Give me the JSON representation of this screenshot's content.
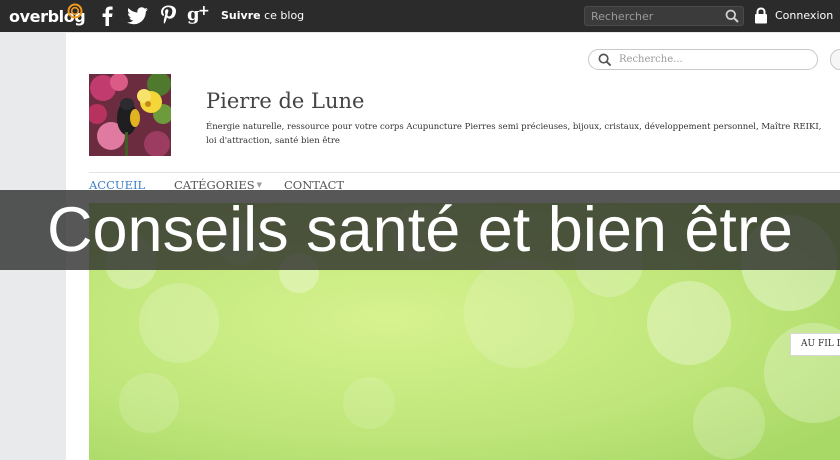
{
  "topbar": {
    "brand": "overblog",
    "social_icons": [
      "facebook-icon",
      "twitter-icon",
      "pinterest-icon",
      "google-plus-icon"
    ],
    "follow_bold": "Suivre",
    "follow_rest": " ce blog",
    "search_placeholder": "Rechercher",
    "login_label": "Connexion"
  },
  "blog": {
    "search_placeholder": "Recherche...",
    "title": "Pierre de Lune",
    "description": "Énergie naturelle, ressource pour votre corps Acupuncture Pierres semi précieuses, bijoux, cristaux, développement personnel, Maître REIKI, loi d'attraction, santé bien être",
    "nav": [
      {
        "label": "ACCUEIL",
        "active": true
      },
      {
        "label": "CATÉGORIES",
        "has_dropdown": true
      },
      {
        "label": "CONTACT"
      }
    ],
    "side_button": "AU FIL DE"
  },
  "overlay_title": "Conseils santé et bien être",
  "colors": {
    "topbar": "#2b2b2b",
    "accent_orange": "#f29a1f",
    "nav_active": "#3b7fc4",
    "hero_green": "#bfe67a",
    "overlay": "#282828"
  }
}
